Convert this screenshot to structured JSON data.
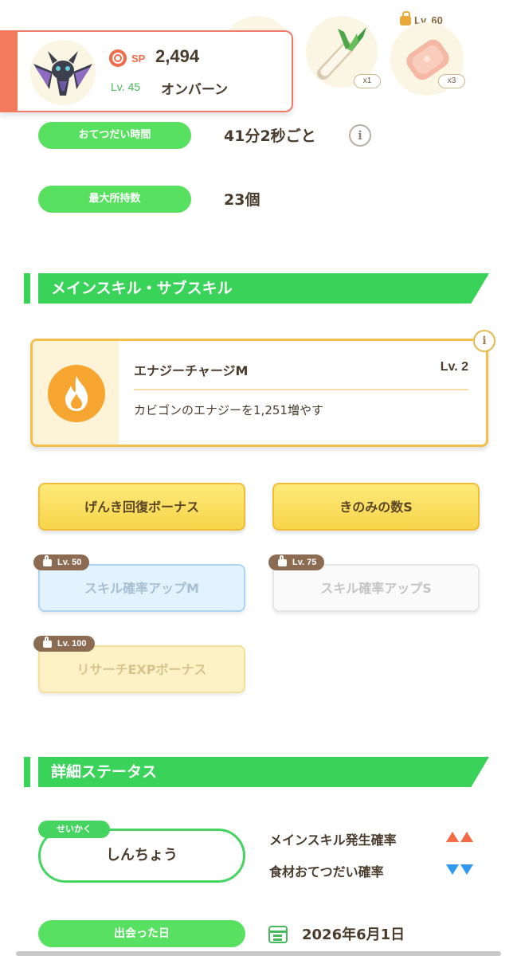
{
  "ingredients": [
    {
      "name": "leek-icon",
      "count": "x1"
    },
    {
      "name": "meat-icon",
      "count": "x3",
      "lock_level": "Lv. 60"
    }
  ],
  "pokemon": {
    "sp_label": "SP",
    "sp_value": "2,494",
    "level": "Lv. 45",
    "name": "オンバーン"
  },
  "stats": [
    {
      "label": "おてつだい時間",
      "value": "41分2秒ごと"
    },
    {
      "label": "最大所持数",
      "value": "23個"
    }
  ],
  "skills_section": {
    "title": "メインスキル・サブスキル",
    "main_skill": {
      "name": "エナジーチャージM",
      "level": "Lv. 2",
      "description": "カビゴンのエナジーを1,251増やす"
    },
    "sub_skills": [
      {
        "label": "げんき回復ボーナス",
        "locked": false
      },
      {
        "label": "きのみの数S",
        "locked": false
      },
      {
        "label": "スキル確率アップM",
        "locked": true,
        "lock_level": "Lv. 50"
      },
      {
        "label": "スキル確率アップS",
        "locked": true,
        "lock_level": "Lv. 75"
      },
      {
        "label": "リサーチEXPボーナス",
        "locked": true,
        "lock_level": "Lv. 100"
      }
    ]
  },
  "detail_section": {
    "title": "詳細ステータス",
    "nature_tag": "せいかく",
    "nature": "しんちょう",
    "effects": [
      {
        "label": "メインスキル発生確率",
        "direction": "up"
      },
      {
        "label": "食材おてつだい確率",
        "direction": "down"
      }
    ],
    "met_label": "出会った日",
    "met_date": "2026年6月1日"
  },
  "colors": {
    "green": "#3ad35a",
    "accent_red": "#f47a5d",
    "gold": "#f2c04a",
    "up_arrow": "#f56a45",
    "down_arrow": "#2f99f0"
  }
}
